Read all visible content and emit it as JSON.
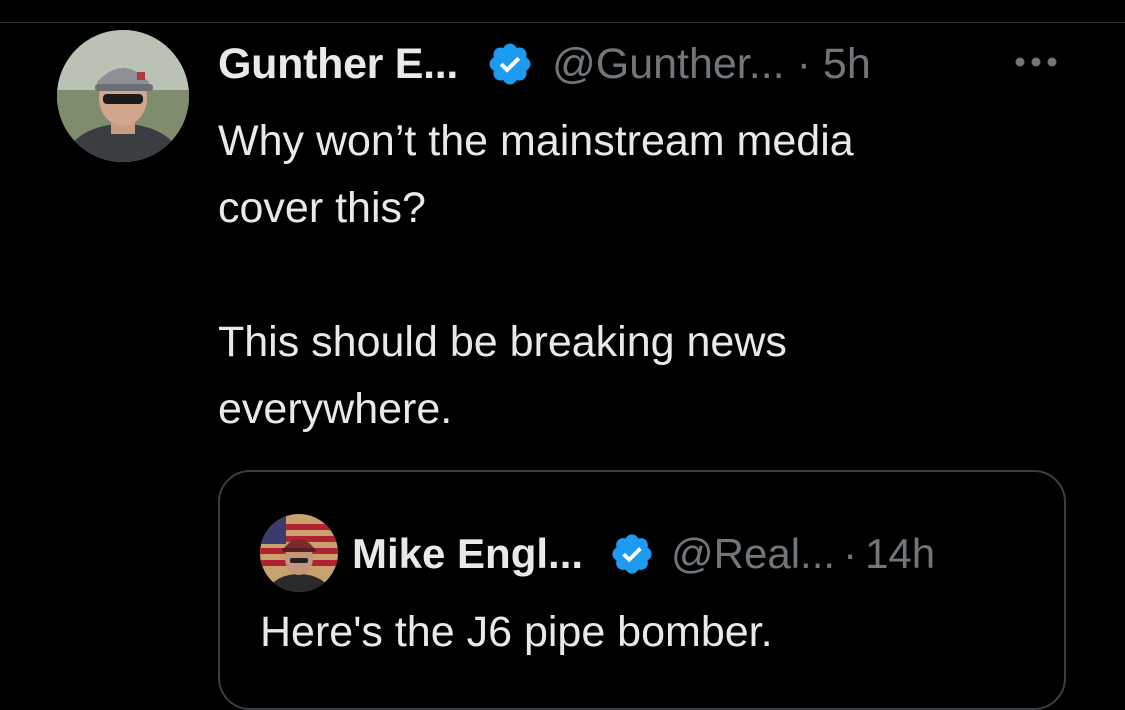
{
  "colors": {
    "background": "#000000",
    "text_primary": "#e7e9ea",
    "text_secondary": "#71767b",
    "verified_blue": "#1d9bf0",
    "border": "#3a3f44"
  },
  "tweet": {
    "author_name": "Gunther E...",
    "handle": "@Gunther...",
    "separator": "·",
    "time": "5h",
    "verified_icon": "verified-badge-icon",
    "more_icon": "more-options-icon",
    "text_lines": [
      "Why won’t the mainstream media",
      "cover this?",
      "This should be breaking news",
      "everywhere."
    ]
  },
  "quote": {
    "author_name": "Mike Engl...",
    "handle": "@Real...",
    "separator": "·",
    "time": "14h",
    "verified_icon": "verified-badge-icon",
    "text": "Here's the J6 pipe bomber."
  }
}
